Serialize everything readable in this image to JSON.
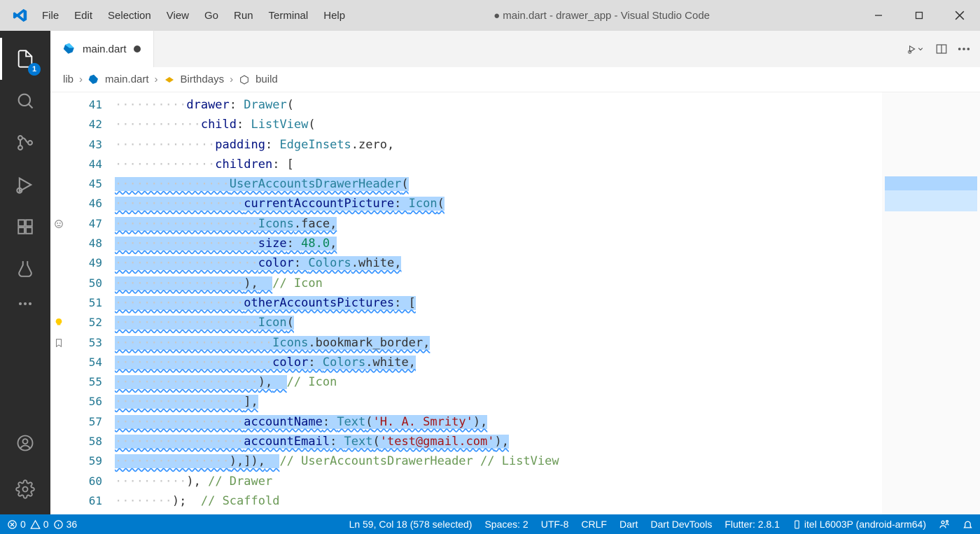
{
  "titlebar": {
    "menu": [
      "File",
      "Edit",
      "Selection",
      "View",
      "Go",
      "Run",
      "Terminal",
      "Help"
    ],
    "title_dirty_dot": "●",
    "title": "main.dart - drawer_app - Visual Studio Code"
  },
  "activitybar": {
    "explorer_badge": "1"
  },
  "tab": {
    "filename": "main.dart"
  },
  "tabs_actions": {
    "run_label": "▷"
  },
  "breadcrumbs": {
    "seg0": "lib",
    "seg1": "main.dart",
    "seg2": "Birthdays",
    "seg3": "build"
  },
  "line_numbers": [
    "41",
    "42",
    "43",
    "44",
    "45",
    "46",
    "47",
    "48",
    "49",
    "50",
    "51",
    "52",
    "53",
    "54",
    "55",
    "56",
    "57",
    "58",
    "59",
    "60",
    "61"
  ],
  "code": {
    "l41": {
      "indent": "          ",
      "a": "drawer",
      "b": ": ",
      "c": "Drawer",
      "d": "("
    },
    "l42": {
      "indent": "            ",
      "a": "child",
      "b": ": ",
      "c": "ListView",
      "d": "("
    },
    "l43": {
      "indent": "              ",
      "a": "padding",
      "b": ": ",
      "c": "EdgeInsets",
      "d": ".zero,"
    },
    "l44": {
      "indent": "              ",
      "a": "children",
      "b": ": [",
      "c": "",
      "d": ""
    },
    "l45": {
      "indent": "                ",
      "a": "UserAccountsDrawerHeader",
      "b": "(",
      "c": "",
      "d": ""
    },
    "l46": {
      "indent": "                  ",
      "a": "currentAccountPicture",
      "b": ": ",
      "c": "Icon",
      "d": "("
    },
    "l47": {
      "indent": "                    ",
      "a": "Icons",
      "b": ".face,",
      "c": "",
      "d": ""
    },
    "l48": {
      "indent": "                    ",
      "a": "size",
      "b": ": ",
      "c": "48.0",
      "d": ","
    },
    "l49": {
      "indent": "                    ",
      "a": "color",
      "b": ": ",
      "c": "Colors",
      "d": ".white,"
    },
    "l50": {
      "indent": "                  ",
      "a": "),",
      "b": "  ",
      "c": "// Icon",
      "d": ""
    },
    "l51": {
      "indent": "                  ",
      "a": "otherAccountsPictures",
      "b": ": [",
      "c": "",
      "d": ""
    },
    "l52": {
      "indent": "                    ",
      "a": "Icon",
      "b": "(",
      "c": "",
      "d": ""
    },
    "l53": {
      "indent": "                      ",
      "a": "Icons",
      "b": ".bookmark_border,",
      "c": "",
      "d": ""
    },
    "l54": {
      "indent": "                      ",
      "a": "color",
      "b": ": ",
      "c": "Colors",
      "d": ".white,"
    },
    "l55": {
      "indent": "                    ",
      "a": "),",
      "b": "  ",
      "c": "// Icon",
      "d": ""
    },
    "l56": {
      "indent": "                  ",
      "a": "],",
      "b": "",
      "c": "",
      "d": ""
    },
    "l57": {
      "indent": "                  ",
      "a": "accountName",
      "b": ": ",
      "c": "Text",
      "d": "(",
      "e": "'H. A. Smrity'",
      "f": "),"
    },
    "l58": {
      "indent": "                  ",
      "a": "accountEmail",
      "b": ": ",
      "c": "Text",
      "d": "(",
      "e": "'test@gmail.com'",
      "f": "),"
    },
    "l59": {
      "indent": "                ",
      "a": "),]),",
      "b": "  ",
      "c": "// UserAccountsDrawerHeader // ListView",
      "d": ""
    },
    "l60": {
      "indent": "          ",
      "a": "),",
      "b": " ",
      "c": "// Drawer",
      "d": ""
    },
    "l61": {
      "indent": "        ",
      "a": ");",
      "b": "  ",
      "c": "// Scaffold",
      "d": ""
    }
  },
  "statusbar": {
    "errors": "0",
    "warnings": "0",
    "info": "36",
    "cursor": "Ln 59, Col 18 (578 selected)",
    "spaces": "Spaces: 2",
    "encoding": "UTF-8",
    "eol": "CRLF",
    "language": "Dart",
    "devtools": "Dart DevTools",
    "flutter": "Flutter: 2.8.1",
    "device": "itel L6003P (android-arm64)"
  }
}
